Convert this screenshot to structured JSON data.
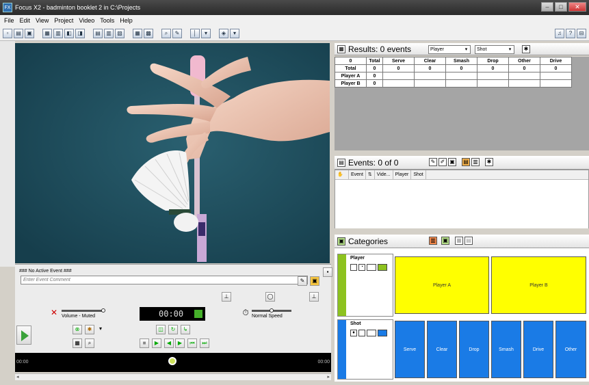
{
  "window": {
    "title": "Focus X2 - badminton booklet 2 in C:\\Projects",
    "app_icon": "FX"
  },
  "menu": [
    "File",
    "Edit",
    "View",
    "Project",
    "Video",
    "Tools",
    "Help"
  ],
  "event_panel": {
    "header": "### No Active Event ###",
    "comment_placeholder": "Enter Event Comment"
  },
  "playback": {
    "time": "00:00",
    "volume_label": "Volume - Muted",
    "speed_label": "Normal Speed",
    "timeline_start": "00:00",
    "timeline_end": "00:00"
  },
  "results": {
    "title": "Results: 0 events",
    "row_dropdown": "Player",
    "col_dropdown": "Shot",
    "columns": [
      "0",
      "Total",
      "Serve",
      "Clear",
      "Smash",
      "Drop",
      "Other",
      "Drive"
    ],
    "rows": [
      {
        "label": "Total",
        "values": [
          "0",
          "0",
          "0",
          "0",
          "0",
          "0",
          "0"
        ]
      },
      {
        "label": "Player A",
        "values": [
          "0",
          "",
          "",
          "",
          "",
          "",
          ""
        ]
      },
      {
        "label": "Player B",
        "values": [
          "0",
          "",
          "",
          "",
          "",
          "",
          ""
        ]
      }
    ]
  },
  "events": {
    "title": "Events: 0 of 0",
    "columns": [
      "Event",
      "Vide...",
      "Player",
      "Shot"
    ]
  },
  "categories": {
    "title": "Categories",
    "groups": [
      {
        "name": "Player",
        "color": "#8dc21f",
        "buttons": [
          "Player A",
          "Player B"
        ],
        "button_color": "#ffff00"
      },
      {
        "name": "Shot",
        "color": "#1a7be6",
        "buttons": [
          "Serve",
          "Clear",
          "Drop",
          "Smash",
          "Drive",
          "Other"
        ],
        "button_color": "#1a7be6"
      }
    ]
  }
}
